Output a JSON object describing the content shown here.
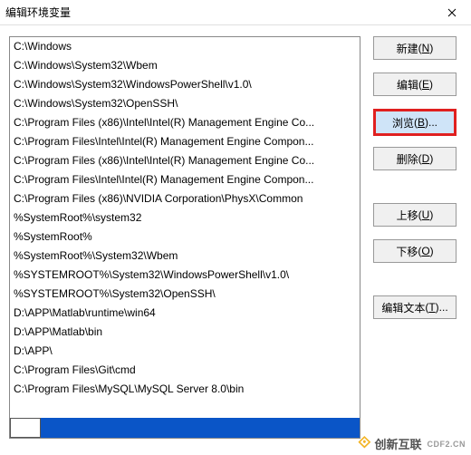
{
  "titlebar": {
    "title": "编辑环境变量"
  },
  "list": {
    "items": [
      "C:\\Windows",
      "C:\\Windows\\System32\\Wbem",
      "C:\\Windows\\System32\\WindowsPowerShell\\v1.0\\",
      "C:\\Windows\\System32\\OpenSSH\\",
      "C:\\Program Files (x86)\\Intel\\Intel(R) Management Engine Co...",
      "C:\\Program Files\\Intel\\Intel(R) Management Engine Compon...",
      "C:\\Program Files (x86)\\Intel\\Intel(R) Management Engine Co...",
      "C:\\Program Files\\Intel\\Intel(R) Management Engine Compon...",
      "C:\\Program Files (x86)\\NVIDIA Corporation\\PhysX\\Common",
      "%SystemRoot%\\system32",
      "%SystemRoot%",
      "%SystemRoot%\\System32\\Wbem",
      "%SYSTEMROOT%\\System32\\WindowsPowerShell\\v1.0\\",
      "%SYSTEMROOT%\\System32\\OpenSSH\\",
      "D:\\APP\\Matlab\\runtime\\win64",
      "D:\\APP\\Matlab\\bin",
      "D:\\APP\\",
      "C:\\Program Files\\Git\\cmd",
      "C:\\Program Files\\MySQL\\MySQL Server 8.0\\bin"
    ]
  },
  "buttons": {
    "new_label": "新建",
    "new_accel": "N",
    "edit_label": "编辑",
    "edit_accel": "E",
    "browse_label": "浏览",
    "browse_accel": "B",
    "delete_label": "删除",
    "delete_accel": "D",
    "moveup_label": "上移",
    "moveup_accel": "U",
    "movedown_label": "下移",
    "movedown_accel": "O",
    "edittext_label": "编辑文本",
    "edittext_accel": "T"
  },
  "watermark": {
    "brand": "创新互联",
    "sub": "CDF2.CN"
  }
}
